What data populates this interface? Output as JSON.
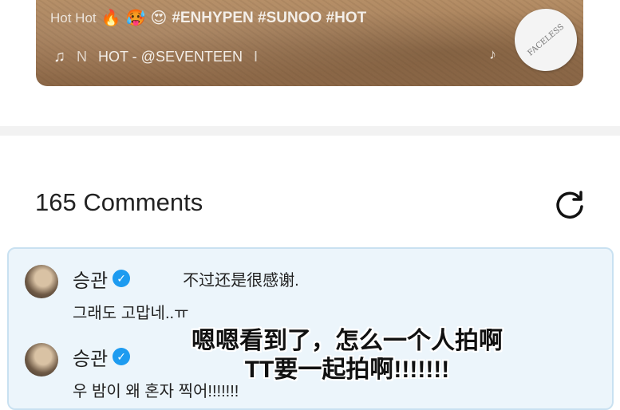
{
  "video": {
    "caption_plain": "Hot Hot",
    "caption_emojis": [
      "🔥",
      "🥵",
      "😍"
    ],
    "caption_tags": "#ENHYPEN #SUNOO #HOT",
    "music_icon": "music-note-icon",
    "music_prefix": "N",
    "music_track": "HOT - @SEVENTEEN",
    "music_suffix": "I",
    "disc_label": "FACELESS"
  },
  "comments_header": {
    "count_label": "165 Comments",
    "refresh_icon": "refresh-icon"
  },
  "comments": [
    {
      "username": "승관",
      "verified": true,
      "translation": "不过还是很感谢.",
      "text": "그래도 고맙네..ㅠ"
    },
    {
      "username": "승관",
      "verified": true,
      "translation": "",
      "text": "우 밤이 왜 혼자 찍어!!!!!!!"
    }
  ],
  "overlay_subtitle": {
    "line1": "嗯嗯看到了，怎么一个人拍啊",
    "line2": "TT要一起拍啊!!!!!!!"
  },
  "colors": {
    "accent_verified": "#1d9bf0",
    "comment_highlight_bg": "#ecf5fb",
    "comment_highlight_border": "#c9e1f1"
  }
}
